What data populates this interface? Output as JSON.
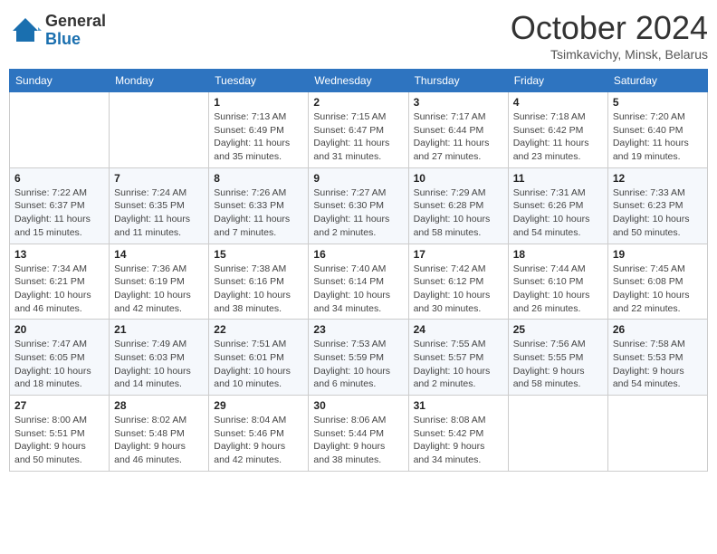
{
  "logo": {
    "general": "General",
    "blue": "Blue"
  },
  "title": "October 2024",
  "location": "Tsimkavichy, Minsk, Belarus",
  "days_of_week": [
    "Sunday",
    "Monday",
    "Tuesday",
    "Wednesday",
    "Thursday",
    "Friday",
    "Saturday"
  ],
  "weeks": [
    [
      {
        "day": "",
        "info": ""
      },
      {
        "day": "",
        "info": ""
      },
      {
        "day": "1",
        "info": "Sunrise: 7:13 AM\nSunset: 6:49 PM\nDaylight: 11 hours\nand 35 minutes."
      },
      {
        "day": "2",
        "info": "Sunrise: 7:15 AM\nSunset: 6:47 PM\nDaylight: 11 hours\nand 31 minutes."
      },
      {
        "day": "3",
        "info": "Sunrise: 7:17 AM\nSunset: 6:44 PM\nDaylight: 11 hours\nand 27 minutes."
      },
      {
        "day": "4",
        "info": "Sunrise: 7:18 AM\nSunset: 6:42 PM\nDaylight: 11 hours\nand 23 minutes."
      },
      {
        "day": "5",
        "info": "Sunrise: 7:20 AM\nSunset: 6:40 PM\nDaylight: 11 hours\nand 19 minutes."
      }
    ],
    [
      {
        "day": "6",
        "info": "Sunrise: 7:22 AM\nSunset: 6:37 PM\nDaylight: 11 hours\nand 15 minutes."
      },
      {
        "day": "7",
        "info": "Sunrise: 7:24 AM\nSunset: 6:35 PM\nDaylight: 11 hours\nand 11 minutes."
      },
      {
        "day": "8",
        "info": "Sunrise: 7:26 AM\nSunset: 6:33 PM\nDaylight: 11 hours\nand 7 minutes."
      },
      {
        "day": "9",
        "info": "Sunrise: 7:27 AM\nSunset: 6:30 PM\nDaylight: 11 hours\nand 2 minutes."
      },
      {
        "day": "10",
        "info": "Sunrise: 7:29 AM\nSunset: 6:28 PM\nDaylight: 10 hours\nand 58 minutes."
      },
      {
        "day": "11",
        "info": "Sunrise: 7:31 AM\nSunset: 6:26 PM\nDaylight: 10 hours\nand 54 minutes."
      },
      {
        "day": "12",
        "info": "Sunrise: 7:33 AM\nSunset: 6:23 PM\nDaylight: 10 hours\nand 50 minutes."
      }
    ],
    [
      {
        "day": "13",
        "info": "Sunrise: 7:34 AM\nSunset: 6:21 PM\nDaylight: 10 hours\nand 46 minutes."
      },
      {
        "day": "14",
        "info": "Sunrise: 7:36 AM\nSunset: 6:19 PM\nDaylight: 10 hours\nand 42 minutes."
      },
      {
        "day": "15",
        "info": "Sunrise: 7:38 AM\nSunset: 6:16 PM\nDaylight: 10 hours\nand 38 minutes."
      },
      {
        "day": "16",
        "info": "Sunrise: 7:40 AM\nSunset: 6:14 PM\nDaylight: 10 hours\nand 34 minutes."
      },
      {
        "day": "17",
        "info": "Sunrise: 7:42 AM\nSunset: 6:12 PM\nDaylight: 10 hours\nand 30 minutes."
      },
      {
        "day": "18",
        "info": "Sunrise: 7:44 AM\nSunset: 6:10 PM\nDaylight: 10 hours\nand 26 minutes."
      },
      {
        "day": "19",
        "info": "Sunrise: 7:45 AM\nSunset: 6:08 PM\nDaylight: 10 hours\nand 22 minutes."
      }
    ],
    [
      {
        "day": "20",
        "info": "Sunrise: 7:47 AM\nSunset: 6:05 PM\nDaylight: 10 hours\nand 18 minutes."
      },
      {
        "day": "21",
        "info": "Sunrise: 7:49 AM\nSunset: 6:03 PM\nDaylight: 10 hours\nand 14 minutes."
      },
      {
        "day": "22",
        "info": "Sunrise: 7:51 AM\nSunset: 6:01 PM\nDaylight: 10 hours\nand 10 minutes."
      },
      {
        "day": "23",
        "info": "Sunrise: 7:53 AM\nSunset: 5:59 PM\nDaylight: 10 hours\nand 6 minutes."
      },
      {
        "day": "24",
        "info": "Sunrise: 7:55 AM\nSunset: 5:57 PM\nDaylight: 10 hours\nand 2 minutes."
      },
      {
        "day": "25",
        "info": "Sunrise: 7:56 AM\nSunset: 5:55 PM\nDaylight: 9 hours\nand 58 minutes."
      },
      {
        "day": "26",
        "info": "Sunrise: 7:58 AM\nSunset: 5:53 PM\nDaylight: 9 hours\nand 54 minutes."
      }
    ],
    [
      {
        "day": "27",
        "info": "Sunrise: 8:00 AM\nSunset: 5:51 PM\nDaylight: 9 hours\nand 50 minutes."
      },
      {
        "day": "28",
        "info": "Sunrise: 8:02 AM\nSunset: 5:48 PM\nDaylight: 9 hours\nand 46 minutes."
      },
      {
        "day": "29",
        "info": "Sunrise: 8:04 AM\nSunset: 5:46 PM\nDaylight: 9 hours\nand 42 minutes."
      },
      {
        "day": "30",
        "info": "Sunrise: 8:06 AM\nSunset: 5:44 PM\nDaylight: 9 hours\nand 38 minutes."
      },
      {
        "day": "31",
        "info": "Sunrise: 8:08 AM\nSunset: 5:42 PM\nDaylight: 9 hours\nand 34 minutes."
      },
      {
        "day": "",
        "info": ""
      },
      {
        "day": "",
        "info": ""
      }
    ]
  ]
}
